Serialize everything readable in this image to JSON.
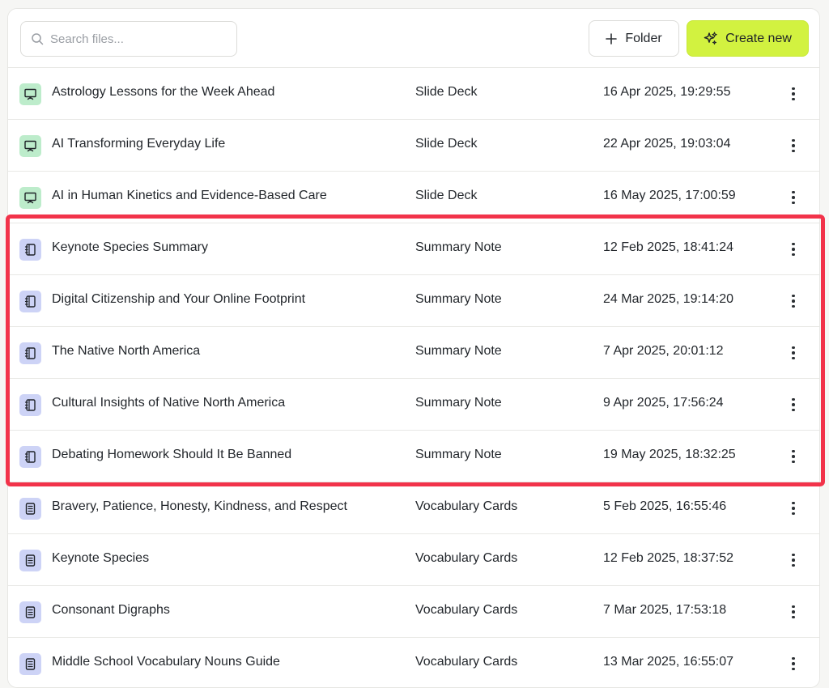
{
  "toolbar": {
    "search_placeholder": "Search files...",
    "folder_label": "Folder",
    "create_label": "Create new"
  },
  "accent_colors": {
    "create_button": "#d2f240",
    "highlight_border": "#f2334a",
    "slide_deck_icon_bg": "#bdeccb",
    "note_icon_bg": "#cdd3f6"
  },
  "files": [
    {
      "name": "Astrology Lessons for the Week Ahead",
      "type": "Slide Deck",
      "date": "16 Apr 2025, 19:29:55",
      "icon": "presentation-icon"
    },
    {
      "name": "AI Transforming Everyday Life",
      "type": "Slide Deck",
      "date": "22 Apr 2025, 19:03:04",
      "icon": "presentation-icon"
    },
    {
      "name": "AI in Human Kinetics and Evidence-Based Care",
      "type": "Slide Deck",
      "date": "16 May 2025, 17:00:59",
      "icon": "presentation-icon"
    },
    {
      "name": "Keynote Species Summary",
      "type": "Summary Note",
      "date": "12 Feb 2025, 18:41:24",
      "icon": "notebook-icon"
    },
    {
      "name": "Digital Citizenship and Your Online Footprint",
      "type": "Summary Note",
      "date": "24 Mar 2025, 19:14:20",
      "icon": "notebook-icon"
    },
    {
      "name": "The Native North America",
      "type": "Summary Note",
      "date": "7 Apr 2025, 20:01:12",
      "icon": "notebook-icon"
    },
    {
      "name": "Cultural Insights of Native North America",
      "type": "Summary Note",
      "date": "9 Apr 2025, 17:56:24",
      "icon": "notebook-icon"
    },
    {
      "name": "Debating Homework Should It Be Banned",
      "type": "Summary Note",
      "date": "19 May 2025, 18:32:25",
      "icon": "notebook-icon"
    },
    {
      "name": "Bravery, Patience, Honesty, Kindness, and Respect",
      "type": "Vocabulary Cards",
      "date": "5 Feb 2025, 16:55:46",
      "icon": "document-list-icon"
    },
    {
      "name": "Keynote Species",
      "type": "Vocabulary Cards",
      "date": "12 Feb 2025, 18:37:52",
      "icon": "document-list-icon"
    },
    {
      "name": "Consonant Digraphs",
      "type": "Vocabulary Cards",
      "date": "7 Mar 2025, 17:53:18",
      "icon": "document-list-icon"
    },
    {
      "name": "Middle School Vocabulary Nouns Guide",
      "type": "Vocabulary Cards",
      "date": "13 Mar 2025, 16:55:07",
      "icon": "document-list-icon"
    }
  ]
}
